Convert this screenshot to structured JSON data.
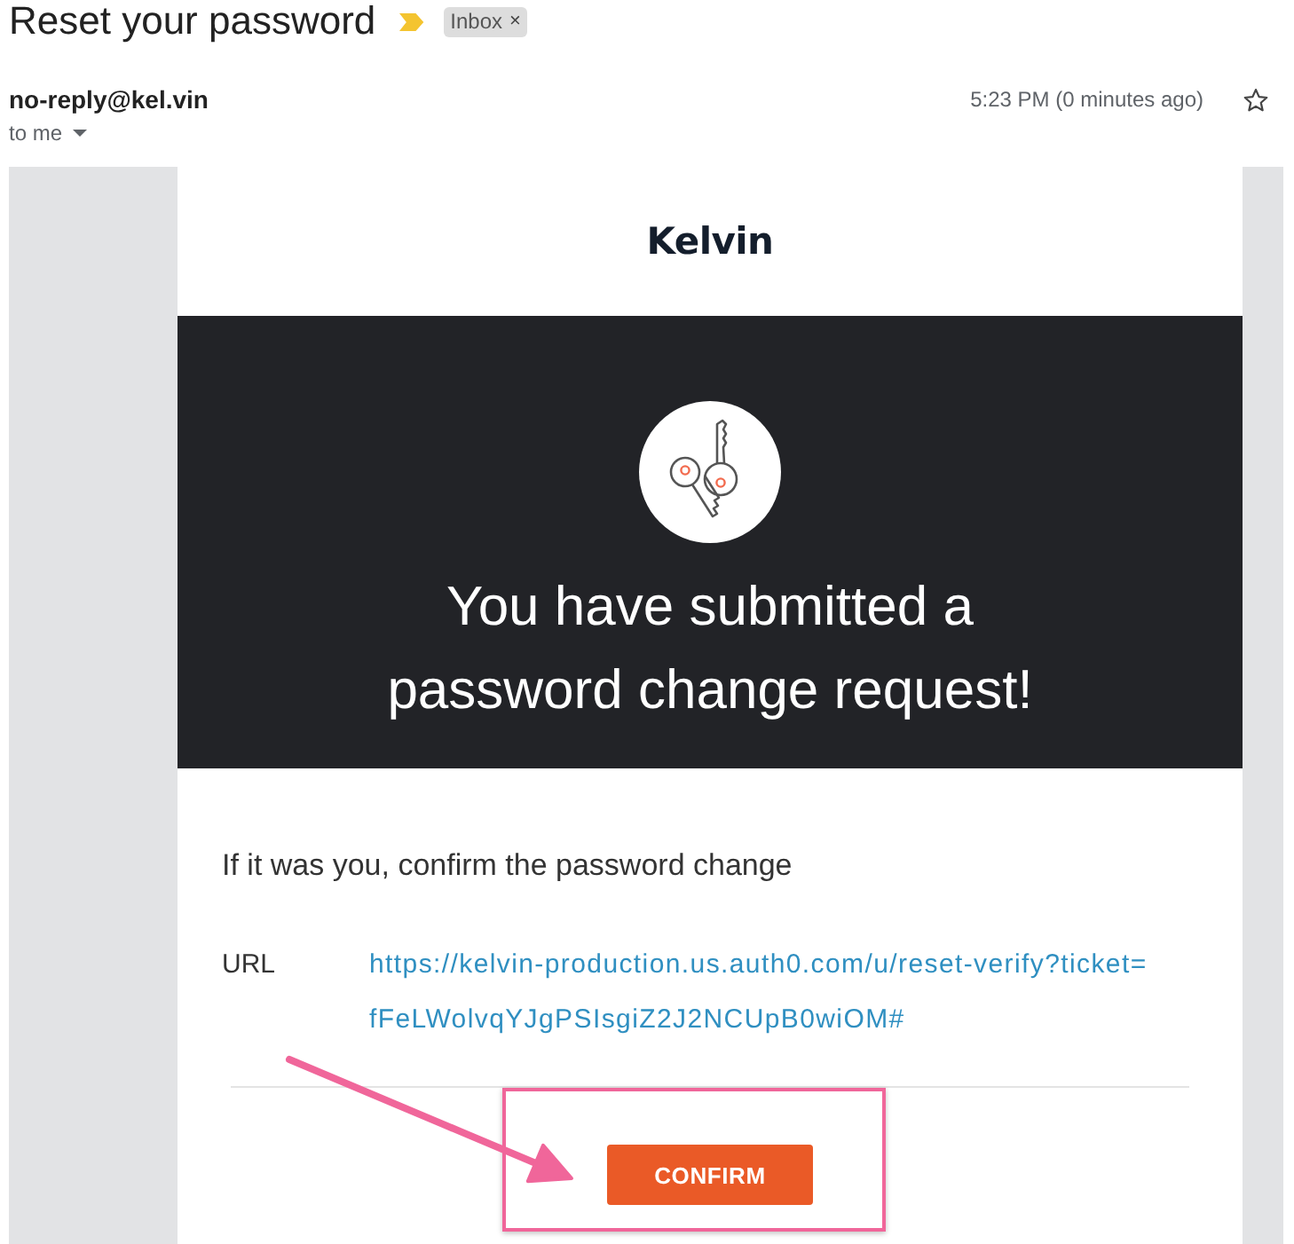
{
  "email": {
    "subject": "Reset your password",
    "important": true,
    "label": {
      "text": "Inbox",
      "remove": "×"
    },
    "sender": "no-reply@kel.vin",
    "recipient": "to me",
    "time": "5:23 PM (0 minutes ago)",
    "starred": false
  },
  "message": {
    "logo": "Kelvin",
    "headline": "You have submitted a password change request!",
    "prompt": "If it was you, confirm the password change",
    "url_label": "URL",
    "url": "https://kelvin-production.us.auth0.com/u/reset-verify?ticket=fFeLWolvqYJgPSIsgiZ2J2NCUpB0wiOM#",
    "button": "CONFIRM"
  }
}
